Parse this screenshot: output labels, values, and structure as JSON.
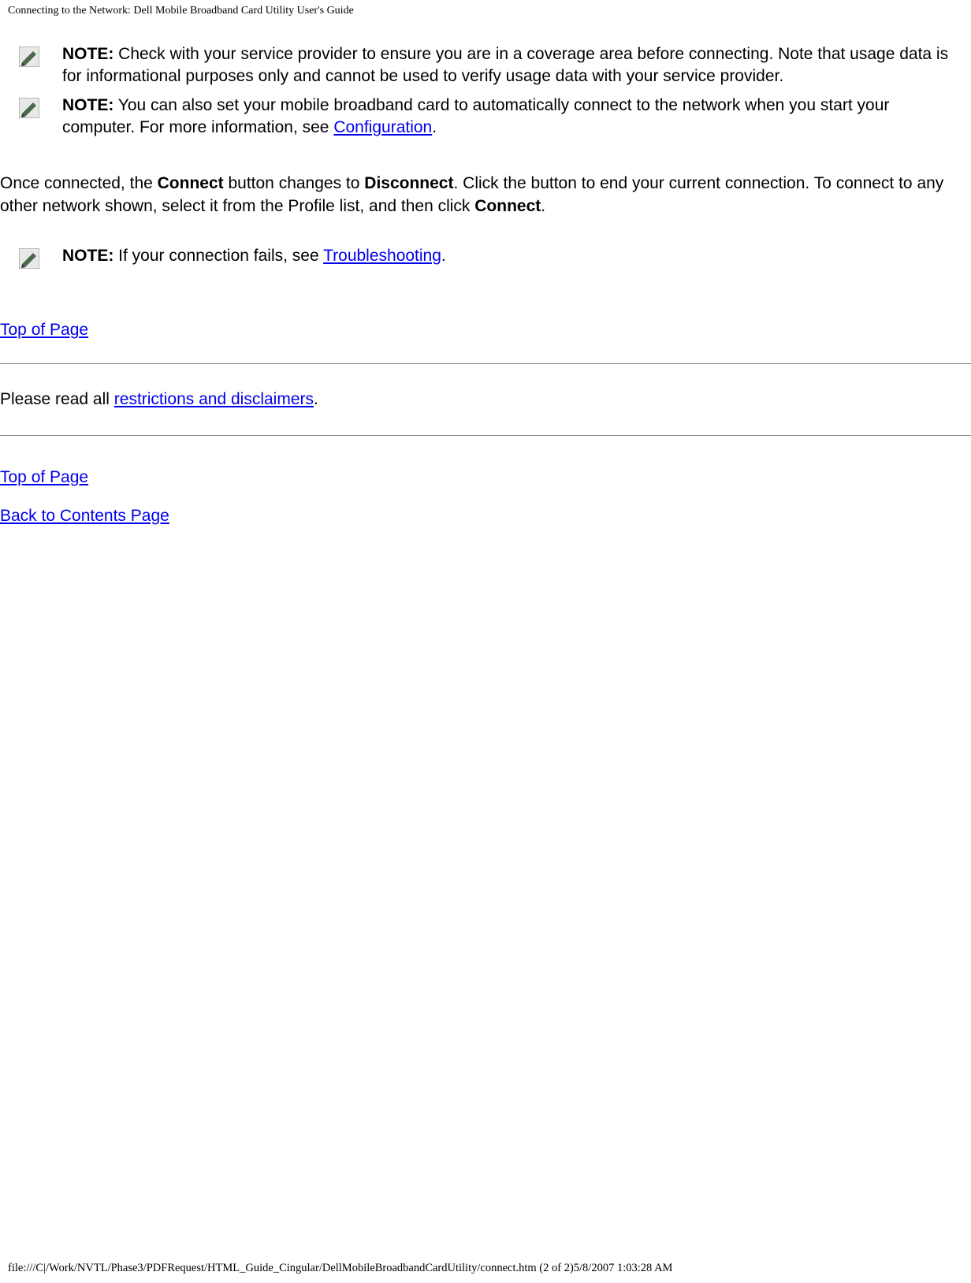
{
  "header": {
    "title": "Connecting to the Network: Dell Mobile Broadband Card Utility User's Guide"
  },
  "notes": {
    "note_label": "NOTE:",
    "n1_text": " Check with your service provider to ensure you are in a coverage area before connecting. Note that usage data is for informational purposes only and cannot be used to verify usage data with your service provider.",
    "n2_text_a": " You can also set your mobile broadband card to automatically connect to the network when you start your computer. For more information, see ",
    "n2_link": "Configuration",
    "n2_text_b": ".",
    "n3_text_a": " If your connection fails, see ",
    "n3_link": "Troubleshooting",
    "n3_text_b": "."
  },
  "paragraph": {
    "p1_a": "Once connected, the ",
    "p1_b": "Connect",
    "p1_c": " button changes to ",
    "p1_d": "Disconnect",
    "p1_e": ". Click the button to end your current connection. To connect to any other network shown, select it from the Profile list, and then click ",
    "p1_f": "Connect",
    "p1_g": "."
  },
  "restrictions": {
    "pre": "Please read all ",
    "link": "restrictions and disclaimers",
    "post": "."
  },
  "links": {
    "top": "Top of Page",
    "back": "Back to Contents Page"
  },
  "footer": {
    "text": "file:///C|/Work/NVTL/Phase3/PDFRequest/HTML_Guide_Cingular/DellMobileBroadbandCardUtility/connect.htm (2 of 2)5/8/2007 1:03:28 AM"
  }
}
